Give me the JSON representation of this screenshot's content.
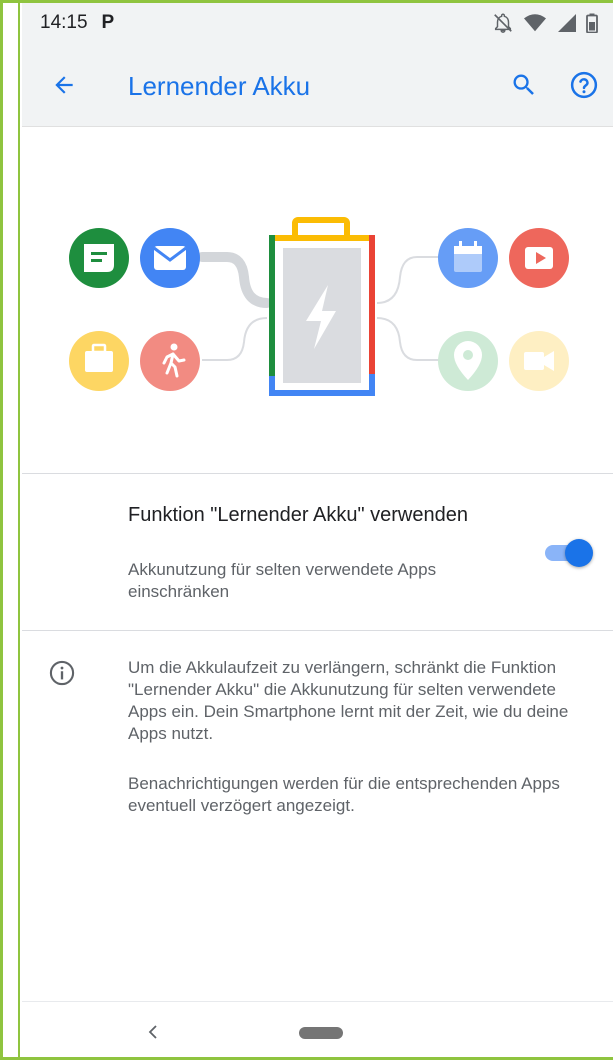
{
  "status_bar": {
    "time": "14:15",
    "notification_letter": "P",
    "icons": [
      "notifications-off-icon",
      "wifi-icon",
      "signal-icon",
      "battery-icon"
    ]
  },
  "app_bar": {
    "title": "Lernender Akku",
    "icons": [
      "back-arrow-icon",
      "search-icon",
      "help-icon"
    ]
  },
  "illustration": {
    "icons_left": [
      "message-icon",
      "mail-icon",
      "briefcase-icon",
      "run-icon"
    ],
    "icons_right": [
      "calendar-icon",
      "play-icon",
      "location-icon",
      "video-icon"
    ],
    "center": "battery-charging-icon"
  },
  "toggle_setting": {
    "title": "Funktion \"Lernender Akku\" verwenden",
    "subtitle": "Akkunutzung für selten verwendete Apps einschränken",
    "enabled": true
  },
  "info": {
    "paragraph1": "Um die Akkulaufzeit zu verlängern, schränkt die Funktion \"Lernender Akku\" die Akkunutzung für selten verwendete Apps ein. Dein Smartphone lernt mit der Zeit, wie du deine Apps nutzt.",
    "paragraph2": "Benachrichtigungen werden für die entsprechenden Apps eventuell verzögert angezeigt."
  },
  "colors": {
    "accent": "#1a73e8",
    "accent_light": "#8ab4f8",
    "app_bar_bg": "#f1f3f4",
    "frame_border": "#8fc43f",
    "google_green": "#1e8e3e",
    "google_blue": "#4285f4",
    "google_yellow": "#fbbc04",
    "google_red": "#ea4335"
  }
}
